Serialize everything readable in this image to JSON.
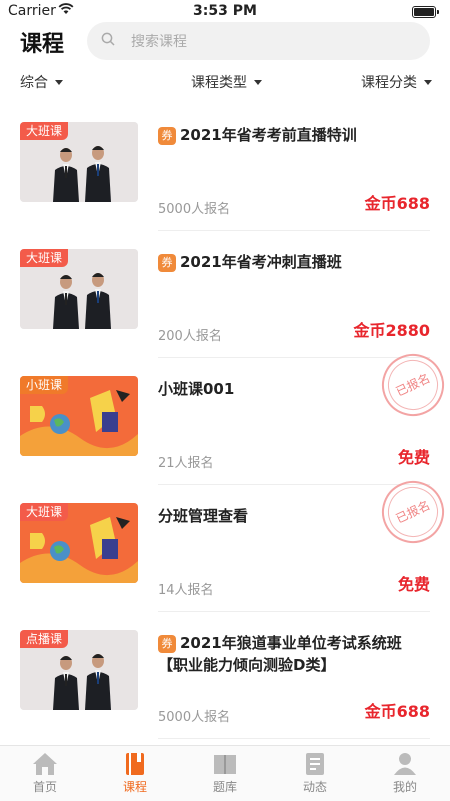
{
  "status_bar": {
    "carrier": "Carrier",
    "time": "3:53 PM"
  },
  "header": {
    "title": "课程",
    "search_placeholder": "搜索课程"
  },
  "filters": [
    {
      "label": "综合"
    },
    {
      "label": "课程类型"
    },
    {
      "label": "课程分类"
    }
  ],
  "courses": [
    {
      "tag": "大班课",
      "tag_color": "#f35b4a",
      "coupon": "券",
      "title": "2021年省考考前直播特训",
      "enrolled": "5000人报名",
      "price": "金币688",
      "stamp": "",
      "thumb": "teachers"
    },
    {
      "tag": "大班课",
      "tag_color": "#f35b4a",
      "coupon": "券",
      "title": "2021年省考冲刺直播班",
      "enrolled": "200人报名",
      "price": "金币2880",
      "stamp": "",
      "thumb": "teachers"
    },
    {
      "tag": "小班课",
      "tag_color": "#f07a2a",
      "coupon": "",
      "title": "小班课001",
      "enrolled": "21人报名",
      "price": "免费",
      "stamp": "已报名",
      "thumb": "illustration"
    },
    {
      "tag": "大班课",
      "tag_color": "#f35b4a",
      "coupon": "",
      "title": "分班管理查看",
      "enrolled": "14人报名",
      "price": "免费",
      "stamp": "已报名",
      "thumb": "illustration"
    },
    {
      "tag": "点播课",
      "tag_color": "#f35b4a",
      "coupon": "券",
      "title": "2021年狼道事业单位考试系统班【职业能力倾向测验D类】",
      "enrolled": "5000人报名",
      "price": "金币688",
      "stamp": "",
      "thumb": "teachers"
    }
  ],
  "tabbar": [
    {
      "label": "首页",
      "icon": "home-icon",
      "active": false
    },
    {
      "label": "课程",
      "icon": "book-icon",
      "active": true
    },
    {
      "label": "题库",
      "icon": "question-bank-icon",
      "active": false
    },
    {
      "label": "动态",
      "icon": "news-icon",
      "active": false
    },
    {
      "label": "我的",
      "icon": "profile-icon",
      "active": false
    }
  ],
  "colors": {
    "accent": "#f06a1e",
    "price": "#e8262d",
    "tag": "#f35b4a"
  }
}
